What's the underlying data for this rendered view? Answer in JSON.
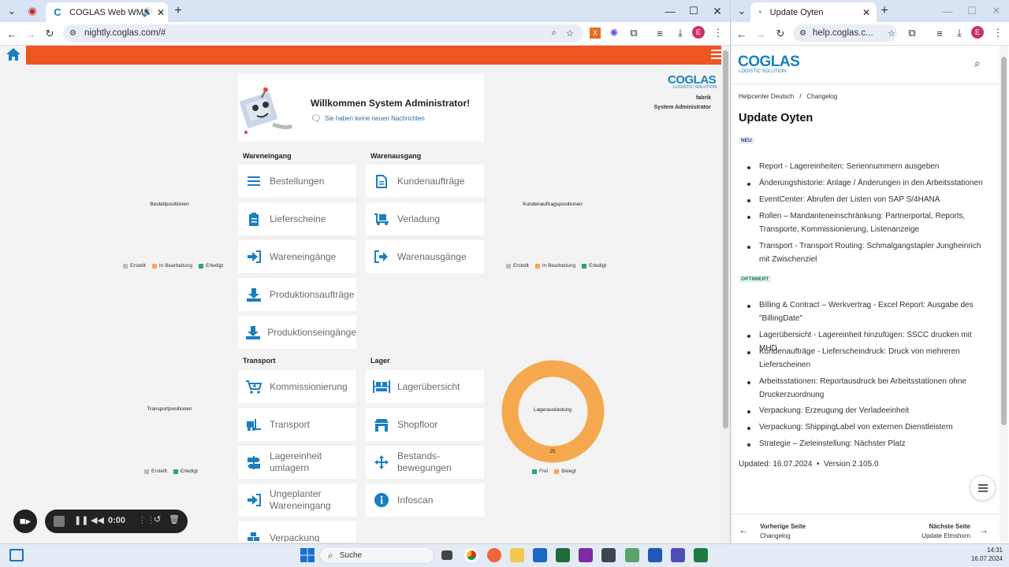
{
  "left_browser": {
    "tab_title": "COGLAS Web WMS",
    "url": "nightly.coglas.com/#",
    "profile_letter": "E"
  },
  "app": {
    "welcome": "Willkommen System Administrator!",
    "messages": "Sie haben keine neuen Nachrichten",
    "logo": "COGLAS",
    "logo_sub": "LOGISTIC SOLUTION",
    "site": "fabrik",
    "user": "System Administrator",
    "sections": {
      "wareneingang": "Wareneingang",
      "warenausgang": "Warenausgang",
      "transport": "Transport",
      "lager": "Lager"
    },
    "tiles": {
      "bestellungen": "Bestellungen",
      "lieferscheine": "Lieferscheine",
      "wareneingaenge": "Wareneingänge",
      "produktionsauftraege": "Produktionsaufträge",
      "produktionseingaenge": "Produktionseingänge",
      "kundenauftraege": "Kundenaufträge",
      "verladung": "Verladung",
      "warenausgaenge": "Warenausgänge",
      "kommissionierung": "Kommissionierung",
      "transport": "Transport",
      "lagereinheit_umlagern_1": "Lagereinheit",
      "lagereinheit_umlagern_2": "umlagern",
      "ungeplanter_1": "Ungeplanter",
      "ungeplanter_2": "Wareneingang",
      "verpackung": "Verpackung",
      "lageruebersicht": "Lagerübersicht",
      "shopfloor": "Shopfloor",
      "bestands_1": "Bestands-",
      "bestands_2": "bewegungen",
      "infoscan": "Infoscan"
    },
    "colors": {
      "accent": "#ee5522",
      "icon": "#1a7fc1",
      "erstellt": "#bbbbbb",
      "in_bearbeitung": "#f6a84e",
      "erledigt": "#24a58c",
      "frei": "#24a58c",
      "belegt": "#f6a84e"
    },
    "charts": {
      "bestellpositionen": {
        "title": "Bestellpositionen",
        "legend": [
          "Erstellt",
          "In Bearbeitung",
          "Erledigt"
        ]
      },
      "kundenauftragspositionen": {
        "title": "Kundenauftragspositionen",
        "legend": [
          "Erstellt",
          "In Bearbeitung",
          "Erledigt"
        ]
      },
      "transportpositionen": {
        "title": "Transportpositionen",
        "legend": [
          "Erstellt",
          "Erledigt"
        ]
      },
      "lagerauslastung": {
        "title": "Lagerauslastung",
        "label": "25",
        "legend": [
          "Frei",
          "Belegt"
        ]
      }
    }
  },
  "chart_data": {
    "type": "pie",
    "title": "Lagerauslastung",
    "categories": [
      "Frei",
      "Belegt"
    ],
    "values": [
      0,
      25
    ]
  },
  "recorder": {
    "time": "0:00"
  },
  "right_browser": {
    "tab_title": "Update Oyten",
    "url": "help.coglas.c...",
    "profile_letter": "E",
    "logo": "COGLAS",
    "logo_sub": "LOGISTIC SOLUTION",
    "breadcrumb_1": "Helpcenter Deutsch",
    "breadcrumb_sep": "/",
    "breadcrumb_2": "Changelog",
    "title": "Update Oyten",
    "badge_new": "NEU",
    "new_items": [
      "Report - Lagereinheiten: Seriennummern ausgeben",
      "Änderungshistorie: Anlage / Änderungen in den Arbeitsstationen",
      "EventCenter: Abrufen der Listen von SAP S/4HANA",
      "Rollen – Mandanteneinschränkung: Partnerportal, Reports, Transporte, Kommissionierung, Listenanzeige",
      "Transport - Transport Routing: Schmalgangstapler Jungheinrich mit Zwischenziel"
    ],
    "badge_opt": "OPTIMIERT",
    "opt_items": [
      "Billing & Contract – Werkvertrag - Excel Report: Ausgabe des \"BillingDate\"",
      "Lagerübersicht - Lagereinheit hinzufügen: SSCC drucken mit MHD",
      "Kundenaufträge - Lieferscheindruck: Druck von mehreren Lieferscheinen",
      "Arbeitsstationen: Reportausdruck bei Arbeitsstationen ohne Druckerzuordnung",
      "Verpackung: Erzeugung der Verladeeinheit",
      "Verpackung: ShippingLabel von externen Dienstleistern",
      "Strategie – Zieleinstellung: Nächster Platz"
    ],
    "updated": "Updated: 16.07.2024  •  Version 2.105.0",
    "prev_label": "Vorherige Seite",
    "prev_page": "Changelog",
    "next_label": "Nächste Seite",
    "next_page": "Update Elmshorn"
  },
  "taskbar": {
    "search": "Suche",
    "time": "14:31",
    "date": "16.07.2024"
  }
}
